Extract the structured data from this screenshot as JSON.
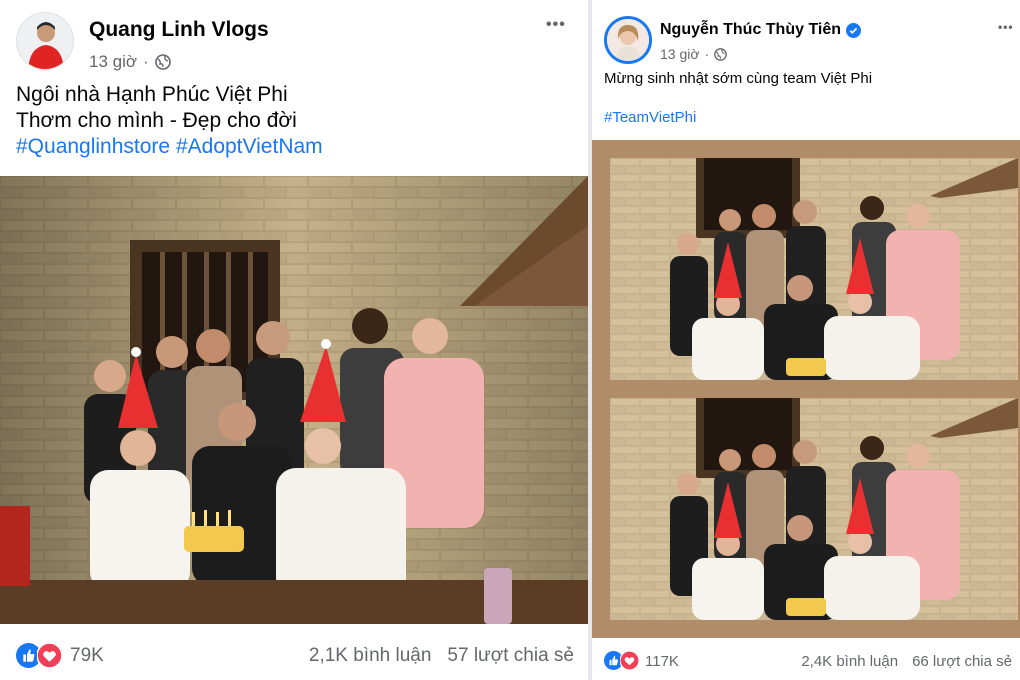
{
  "left_post": {
    "author": "Quang Linh Vlogs",
    "time": "13 giờ",
    "separator": "·",
    "audience_icon": "globe-icon",
    "more_label": "•••",
    "lines": [
      "Ngôi nhà Hạnh Phúc Việt Phi",
      "Thơm cho mình - Đẹp cho đời"
    ],
    "hashtags": [
      "#Quanglinhstore",
      "#AdoptVietNam"
    ],
    "reaction_count": "79K",
    "comments": "2,1K bình luận",
    "shares": "57 lượt chia sẻ",
    "reaction_icons": [
      "like-icon",
      "love-icon"
    ]
  },
  "right_post": {
    "author": "Nguyễn Thúc Thùy Tiên",
    "verified_icon": "verified-badge-icon",
    "time": "13 giờ",
    "separator": "·",
    "audience_icon": "globe-icon",
    "more_label": "•••",
    "text": "Mừng sinh nhật sớm cùng team Việt Phi",
    "hashtag": "#TeamVietPhi",
    "reaction_count": "117K",
    "comments": "2,4K bình luận",
    "shares": "66 lượt chia sẻ",
    "reaction_icons": [
      "like-icon",
      "love-icon"
    ]
  },
  "colors": {
    "link": "#1877f2",
    "muted": "#65676b",
    "like": "#1877f2",
    "love": "#f33e58",
    "photo_frame": "#b08d68"
  }
}
